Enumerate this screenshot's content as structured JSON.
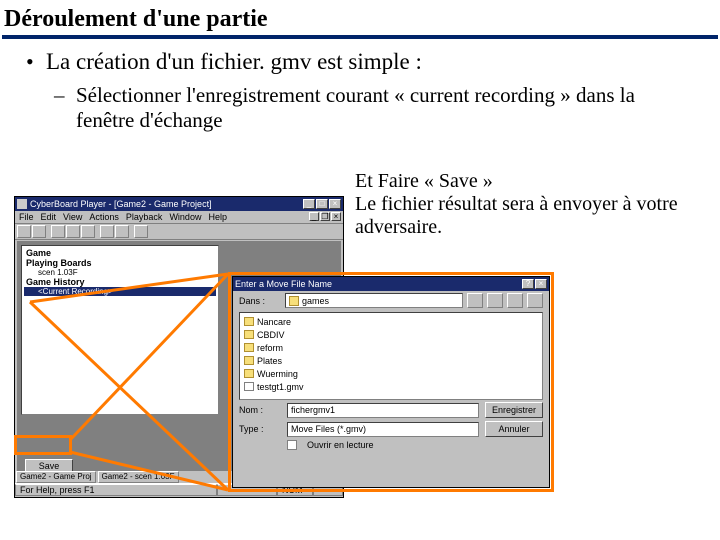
{
  "slide": {
    "title": "Déroulement d'une partie",
    "bullet1": "La création d'un fichier. gmv est simple :",
    "bullet2": "Sélectionner l'enregistrement courant « current recording » dans la fenêtre d'échange",
    "para": "Et Faire « Save »\nLe fichier résultat sera à envoyer à votre adversaire."
  },
  "app": {
    "title": "CyberBoard Player - [Game2 - Game Project]",
    "menu": [
      "File",
      "Edit",
      "View",
      "Actions",
      "Playback",
      "Window",
      "Help"
    ],
    "tree": {
      "root": "Game",
      "n1": "Playing Boards",
      "n1a": "scen 1.03F",
      "n2": "Game History",
      "sel": "<Current Recording>"
    },
    "save_btn": "Save",
    "tabs": [
      "Game2 - Game Proj",
      "Game2 - scen 1.03F"
    ],
    "status_help": "For Help, press F1",
    "status_num": "NUM"
  },
  "dialog": {
    "title": "Enter a Move File Name",
    "lookin_label": "Dans :",
    "lookin_value": "games",
    "files": [
      {
        "name": "Nancare",
        "type": "dir"
      },
      {
        "name": "CBDIV",
        "type": "dir"
      },
      {
        "name": "reform",
        "type": "dir"
      },
      {
        "name": "Plates",
        "type": "dir"
      },
      {
        "name": "Wuerming",
        "type": "dir"
      },
      {
        "name": "testgt1.gmv",
        "type": "file"
      }
    ],
    "name_label": "Nom :",
    "name_value": "fichergmv1",
    "type_label": "Type :",
    "type_value": "Move Files (*.gmv)",
    "readonly_label": "Ouvrir en lecture",
    "save_btn": "Enregistrer",
    "cancel_btn": "Annuler"
  }
}
